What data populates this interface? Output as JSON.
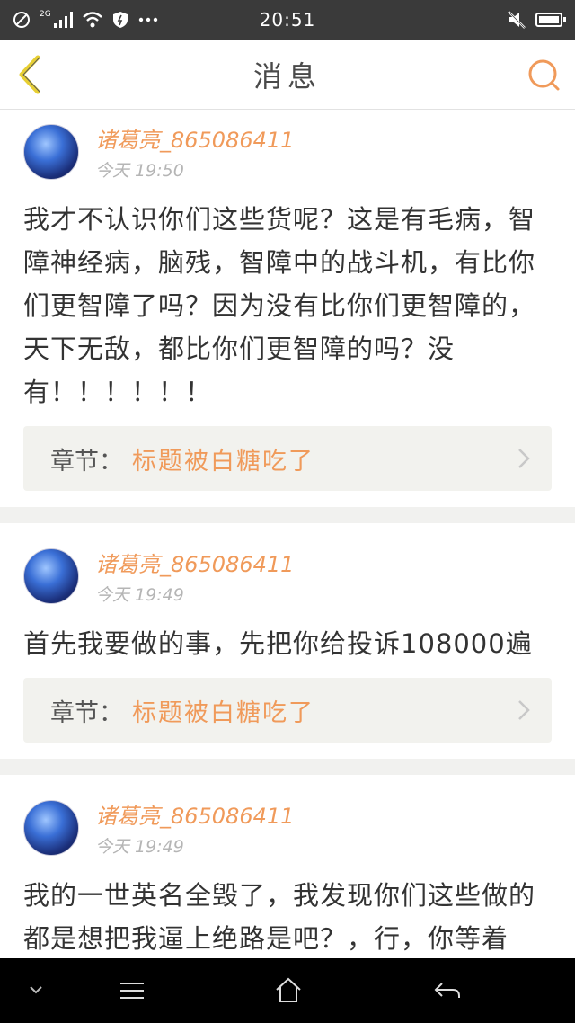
{
  "status_bar": {
    "network": "2G",
    "time": "20:51",
    "icons": [
      "no-sim-icon",
      "signal-icon",
      "wifi-icon",
      "shield-icon",
      "more-icon",
      "mute-icon",
      "battery-icon"
    ]
  },
  "header": {
    "title": "消息",
    "back_icon": "chevron-left-icon",
    "search_icon": "search-icon",
    "accent": "#f09a5a"
  },
  "messages": [
    {
      "username": "诸葛亮_865086411",
      "time": "今天 19:50",
      "text": "我才不认识你们这些货呢？这是有毛病，智障神经病，脑残，智障中的战斗机，有比你们更智障了吗？因为没有比你们更智障的，天下无敌，都比你们更智障的吗？没有！！！！！！",
      "chapter_label": "章节：",
      "chapter_title": "标题被白糖吃了"
    },
    {
      "username": "诸葛亮_865086411",
      "time": "今天 19:49",
      "text": "首先我要做的事，先把你给投诉108000遍",
      "chapter_label": "章节：",
      "chapter_title": "标题被白糖吃了"
    },
    {
      "username": "诸葛亮_865086411",
      "time": "今天 19:49",
      "text": "我的一世英名全毁了，我发现你们这些做的都是想把我逼上绝路是吧？，行，你等着的，你看我不在我的问题把你给写死，让你们直接领饭盒去，你等着吧"
    }
  ],
  "nav_bar": {
    "icons": [
      "chevron-down-icon",
      "menu-icon",
      "home-icon",
      "back-icon"
    ]
  }
}
